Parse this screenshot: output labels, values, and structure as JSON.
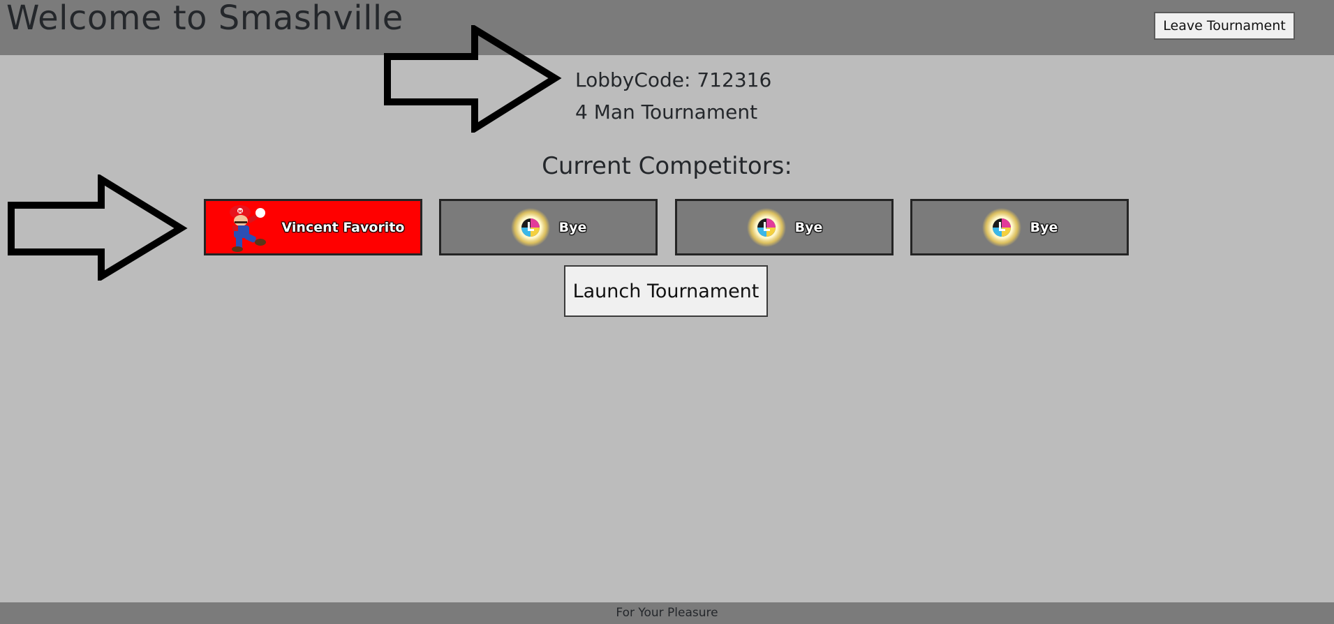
{
  "header": {
    "title": "Welcome to Smashville",
    "leave_label": "Leave Tournament"
  },
  "lobby": {
    "code_text": "LobbyCode: 712316",
    "type_text": "4 Man Tournament"
  },
  "competitors": {
    "title": "Current Competitors:",
    "items": [
      {
        "name": "Vincent Favorito",
        "icon": "mario-icon",
        "color": "#ff0000",
        "active": true
      },
      {
        "name": "Bye",
        "icon": "smash-ball-icon",
        "color": "#7b7b7b",
        "active": false
      },
      {
        "name": "Bye",
        "icon": "smash-ball-icon",
        "color": "#7b7b7b",
        "active": false
      },
      {
        "name": "Bye",
        "icon": "smash-ball-icon",
        "color": "#7b7b7b",
        "active": false
      }
    ]
  },
  "actions": {
    "launch_label": "Launch Tournament"
  },
  "footer": {
    "text": "For Your Pleasure"
  },
  "colors": {
    "background": "#bcbcbc",
    "bars": "#7b7b7b",
    "active_competitor": "#ff0000",
    "text": "#24272b"
  }
}
